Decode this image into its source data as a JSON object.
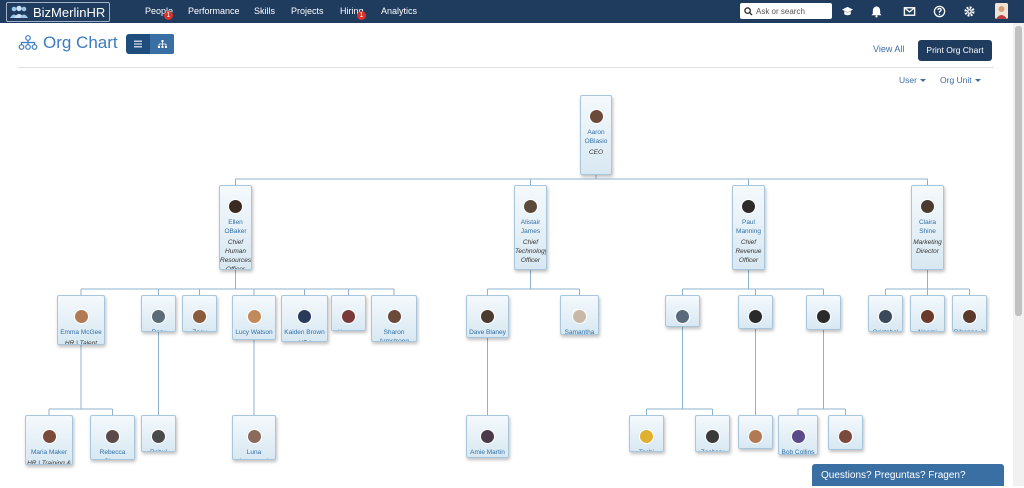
{
  "header": {
    "brand": "BizMerlinHR",
    "nav": [
      {
        "label": "People",
        "badge": "1"
      },
      {
        "label": "Performance"
      },
      {
        "label": "Skills"
      },
      {
        "label": "Projects"
      },
      {
        "label": "Hiring",
        "badge": "1"
      },
      {
        "label": "Analytics"
      }
    ],
    "search_placeholder": "Ask or search",
    "icons": [
      "graduation-cap-icon",
      "bell-icon",
      "mail-icon",
      "help-icon",
      "gear-icon",
      "user-avatar"
    ]
  },
  "page": {
    "title": "Org Chart",
    "view_all": "View All",
    "print_button": "Print Org Chart",
    "filter_user": "User",
    "filter_org_unit": "Org Unit"
  },
  "org": [
    {
      "id": "aaron",
      "name": "Aaron OBlasio",
      "title": "CEO",
      "parent": null,
      "avatar_color": "#6b4a3a"
    },
    {
      "id": "ellen",
      "name": "Ellen OBaker",
      "title": "Chief Human Resources Officer",
      "parent": "aaron",
      "avatar_color": "#3a2a22"
    },
    {
      "id": "alistair",
      "name": "Alistair James",
      "title": "Chief Technology Officer",
      "parent": "aaron",
      "avatar_color": "#5a4a3c"
    },
    {
      "id": "paul",
      "name": "Paul Manning",
      "title": "Chief Revenue Officer",
      "parent": "aaron",
      "avatar_color": "#2f2a2a"
    },
    {
      "id": "claira",
      "name": "Claira Shine",
      "title": "Marketing Director",
      "parent": "aaron",
      "avatar_color": "#4a3a30"
    },
    {
      "id": "emma",
      "name": "Emma McGee",
      "title": "HR | Talent Development Officer",
      "parent": "ellen",
      "avatar_color": "#b07a55"
    },
    {
      "id": "rory",
      "name": "Rory Adaira",
      "title": "HR | Specialist - Benefits & Payroll",
      "parent": "ellen",
      "avatar_color": "#5c6a78"
    },
    {
      "id": "zoey",
      "name": "Zoey Barton",
      "title": "HR | Diversity & Inclusion Specialist",
      "parent": "ellen",
      "avatar_color": "#8a5a3c"
    },
    {
      "id": "lucy",
      "name": "Lucy Watson",
      "title": "HR | Talent Acquisition Manager",
      "parent": "ellen",
      "avatar_color": "#c08a5a"
    },
    {
      "id": "kaiden",
      "name": "Kaiden Brown",
      "title": "HR | Compliance, Safety & Security Specialist",
      "parent": "ellen",
      "avatar_color": "#2a3a5a"
    },
    {
      "id": "kareen",
      "name": "Kareen Swan",
      "title": "Sales Manager",
      "parent": "ellen",
      "avatar_color": "#7a3a3a"
    },
    {
      "id": "sharon",
      "name": "Sharon Armstrong",
      "title": "Director of Employee Engagement",
      "parent": "ellen",
      "avatar_color": "#6a4a3a"
    },
    {
      "id": "dave",
      "name": "Dave Blaney",
      "title": "Director, Technology",
      "parent": "alistair",
      "avatar_color": "#4a3a30"
    },
    {
      "id": "samantha",
      "name": "Samantha Conner",
      "title": "Director, DevOps",
      "parent": "alistair",
      "avatar_color": "#c9b8a8"
    },
    {
      "id": "michael",
      "name": "Michael London",
      "title": "Sr. VP, Sales",
      "parent": "paul",
      "avatar_color": "#5a6a7a"
    },
    {
      "id": "johnm1",
      "name": "John Morris",
      "title": "Business Analyst",
      "parent": "paul",
      "avatar_color": "#2a2a2a"
    },
    {
      "id": "johnm2",
      "name": "John Morris",
      "title": "VP - Finance",
      "parent": "paul",
      "avatar_color": "#2a2a2a"
    },
    {
      "id": "cristobal",
      "name": "Cristobal Colon",
      "title": "Marketing Manager",
      "parent": "claira",
      "avatar_color": "#3a4a5a"
    },
    {
      "id": "naomi",
      "name": "Naomi Chow",
      "title": "Store Manager",
      "parent": "claira",
      "avatar_color": "#6a3a2a"
    },
    {
      "id": "rihanna",
      "name": "Rihanna Jr",
      "title": "Brand Manager",
      "parent": "claira",
      "avatar_color": "#5a3a2a"
    },
    {
      "id": "maria",
      "name": "Maria Maker",
      "title": "HR | Training & Development",
      "parent": "emma",
      "avatar_color": "#7a4a3a"
    },
    {
      "id": "rebecca",
      "name": "Rebecca Shaw",
      "title": "HR | Performance",
      "parent": "emma",
      "avatar_color": "#5a4a4a"
    },
    {
      "id": "rahul",
      "name": "Rahul Morales",
      "title": "HR | Benefits",
      "parent": "rory",
      "avatar_color": "#4a4a4a"
    },
    {
      "id": "luna",
      "name": "Luna Lovegood",
      "title": "HR | Campus",
      "parent": "lucy",
      "avatar_color": "#8a6a5a"
    },
    {
      "id": "amie",
      "name": "Amie Martin",
      "title": "Senior Software",
      "parent": "dave",
      "avatar_color": "#4a3a4a"
    },
    {
      "id": "tashi",
      "name": "Tashi Mathew",
      "title": "Sales",
      "parent": "michael",
      "avatar_color": "#e0b030"
    },
    {
      "id": "zachary",
      "name": "Zachary Taylor",
      "title": "Account",
      "parent": "michael",
      "avatar_color": "#3a3a3a"
    },
    {
      "id": "steve",
      "name": "Steve Harvy",
      "title": "Manager",
      "parent": "johnm1",
      "avatar_color": "#b07a55"
    },
    {
      "id": "bob",
      "name": "Bob Collins",
      "title": "Accountant",
      "parent": "johnm2",
      "avatar_color": "#5a4a8a"
    },
    {
      "id": "mary",
      "name": "Mary",
      "title": "",
      "parent": "johnm2",
      "avatar_color": "#7a4a3a"
    }
  ],
  "chat": {
    "label": "Questions? Preguntas? Fragen?"
  }
}
